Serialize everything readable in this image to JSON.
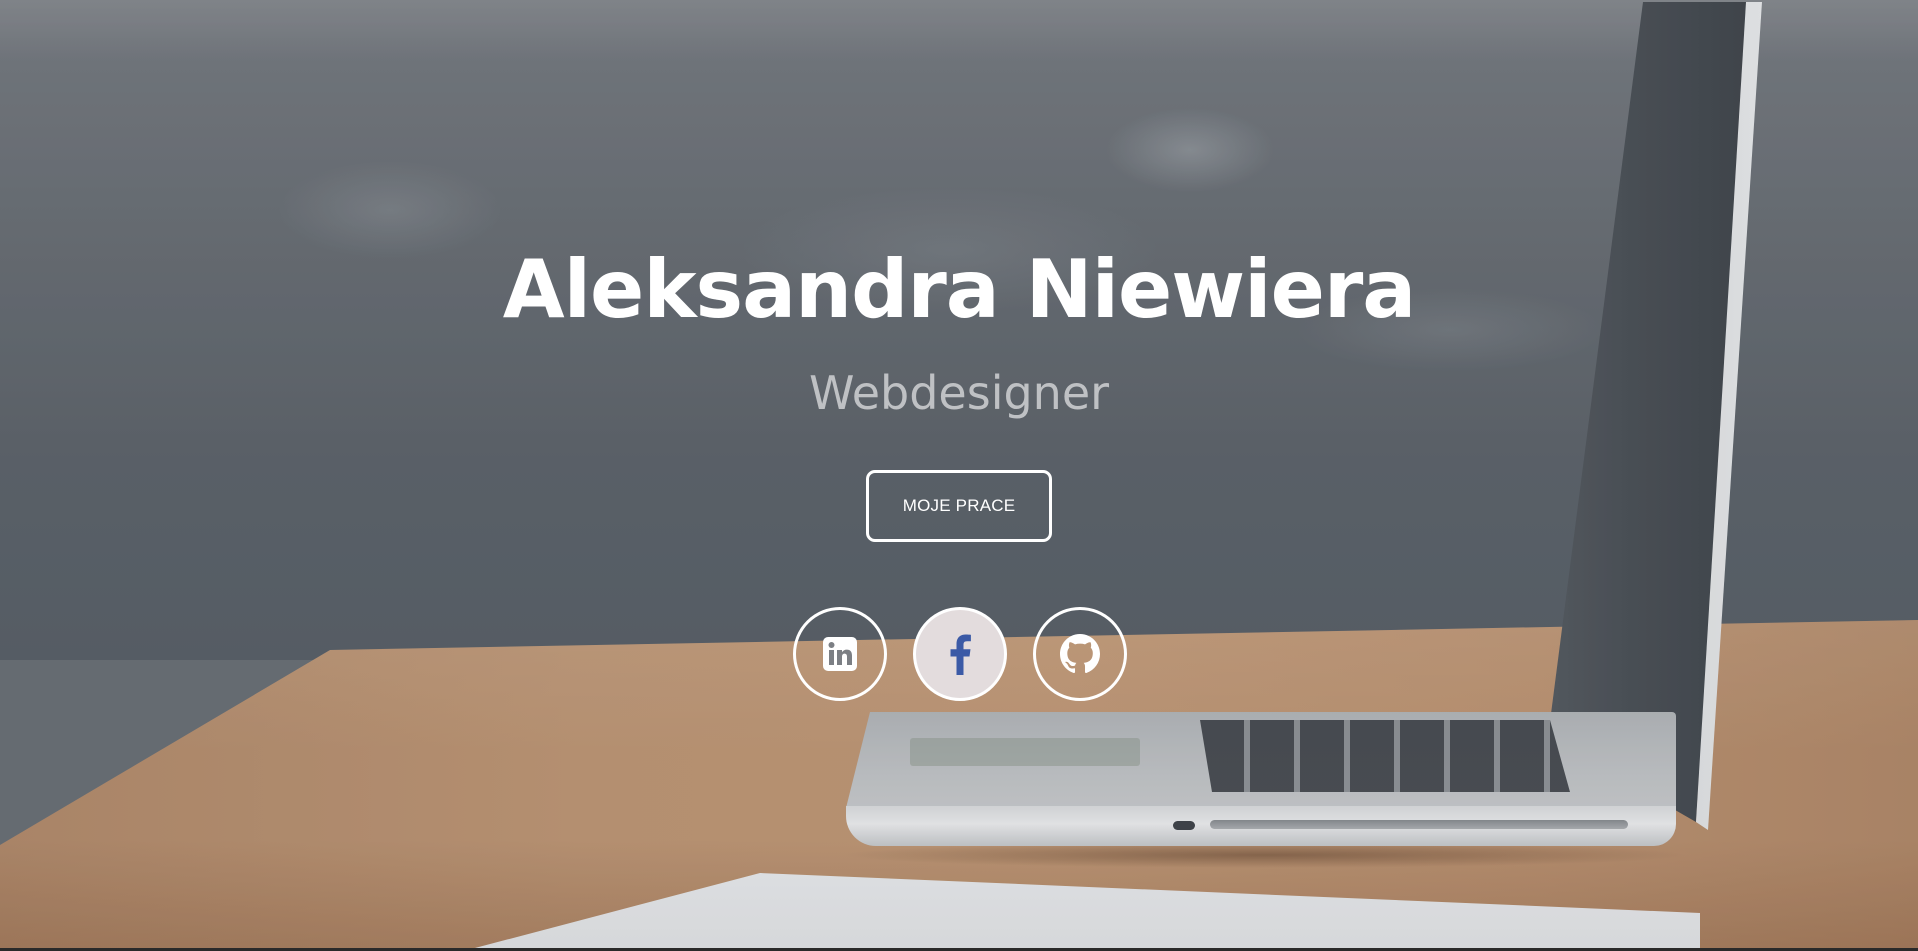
{
  "hero": {
    "name": "Aleksandra Niewiera",
    "role": "Webdesigner",
    "cta_label": "MOJE PRACE"
  },
  "social": [
    {
      "network": "LinkedIn",
      "icon": "linkedin-icon",
      "color": "#ffffff"
    },
    {
      "network": "Facebook",
      "icon": "facebook-icon",
      "color": "#3b5aa6",
      "background": "#e3dcdd"
    },
    {
      "network": "GitHub",
      "icon": "github-icon",
      "color": "#ffffff"
    }
  ],
  "colors": {
    "text_primary": "#ffffff",
    "text_muted": "#bfc1c4",
    "facebook_blue": "#3b5aa6"
  }
}
